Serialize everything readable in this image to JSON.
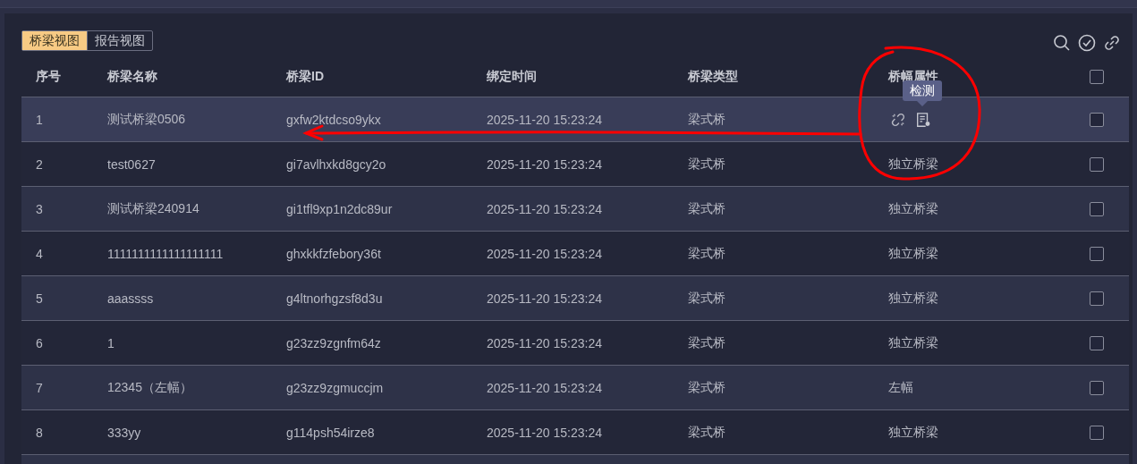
{
  "view_tabs": [
    {
      "label": "桥梁视图",
      "selected": true
    },
    {
      "label": "报告视图",
      "selected": false
    }
  ],
  "table": {
    "columns": [
      "序号",
      "桥梁名称",
      "桥梁ID",
      "绑定时间",
      "桥梁类型",
      "桥幅属性"
    ],
    "header_checked": false,
    "rows": [
      {
        "index": "1",
        "name": "测试桥梁0506",
        "id": "gxfw2ktdcso9ykx",
        "bound_time": "2025-11-20 15:23:24",
        "type": "梁式桥",
        "hovered": true,
        "tooltip": "检测",
        "checked": false
      },
      {
        "index": "2",
        "name": "test0627",
        "id": "gi7avlhxkd8gcy2o",
        "bound_time": "2025-11-20 15:23:24",
        "type": "梁式桥",
        "attribute": "独立桥梁",
        "hovered": false,
        "checked": false
      },
      {
        "index": "3",
        "name": "测试桥梁240914",
        "id": "gi1tfl9xp1n2dc89ur",
        "bound_time": "2025-11-20 15:23:24",
        "type": "梁式桥",
        "attribute": "独立桥梁",
        "hovered": false,
        "checked": false
      },
      {
        "index": "4",
        "name": "1111111111111111111",
        "id": "ghxkkfzfebory36t",
        "bound_time": "2025-11-20 15:23:24",
        "type": "梁式桥",
        "attribute": "独立桥梁",
        "hovered": false,
        "checked": false
      },
      {
        "index": "5",
        "name": "aaassss",
        "id": "g4ltnorhgzsf8d3u",
        "bound_time": "2025-11-20 15:23:24",
        "type": "梁式桥",
        "attribute": "独立桥梁",
        "hovered": false,
        "checked": false
      },
      {
        "index": "6",
        "name": "1",
        "id": "g23zz9zgnfm64z",
        "bound_time": "2025-11-20 15:23:24",
        "type": "梁式桥",
        "attribute": "独立桥梁",
        "hovered": false,
        "checked": false
      },
      {
        "index": "7",
        "name": "12345（左幅）",
        "id": "g23zz9zgmuccjm",
        "bound_time": "2025-11-20 15:23:24",
        "type": "梁式桥",
        "attribute": "左幅",
        "hovered": false,
        "checked": false
      },
      {
        "index": "8",
        "name": "333yy",
        "id": "g114psh54irze8",
        "bound_time": "2025-11-20 15:23:24",
        "type": "梁式桥",
        "attribute": "独立桥梁",
        "hovered": false,
        "checked": false
      }
    ]
  }
}
